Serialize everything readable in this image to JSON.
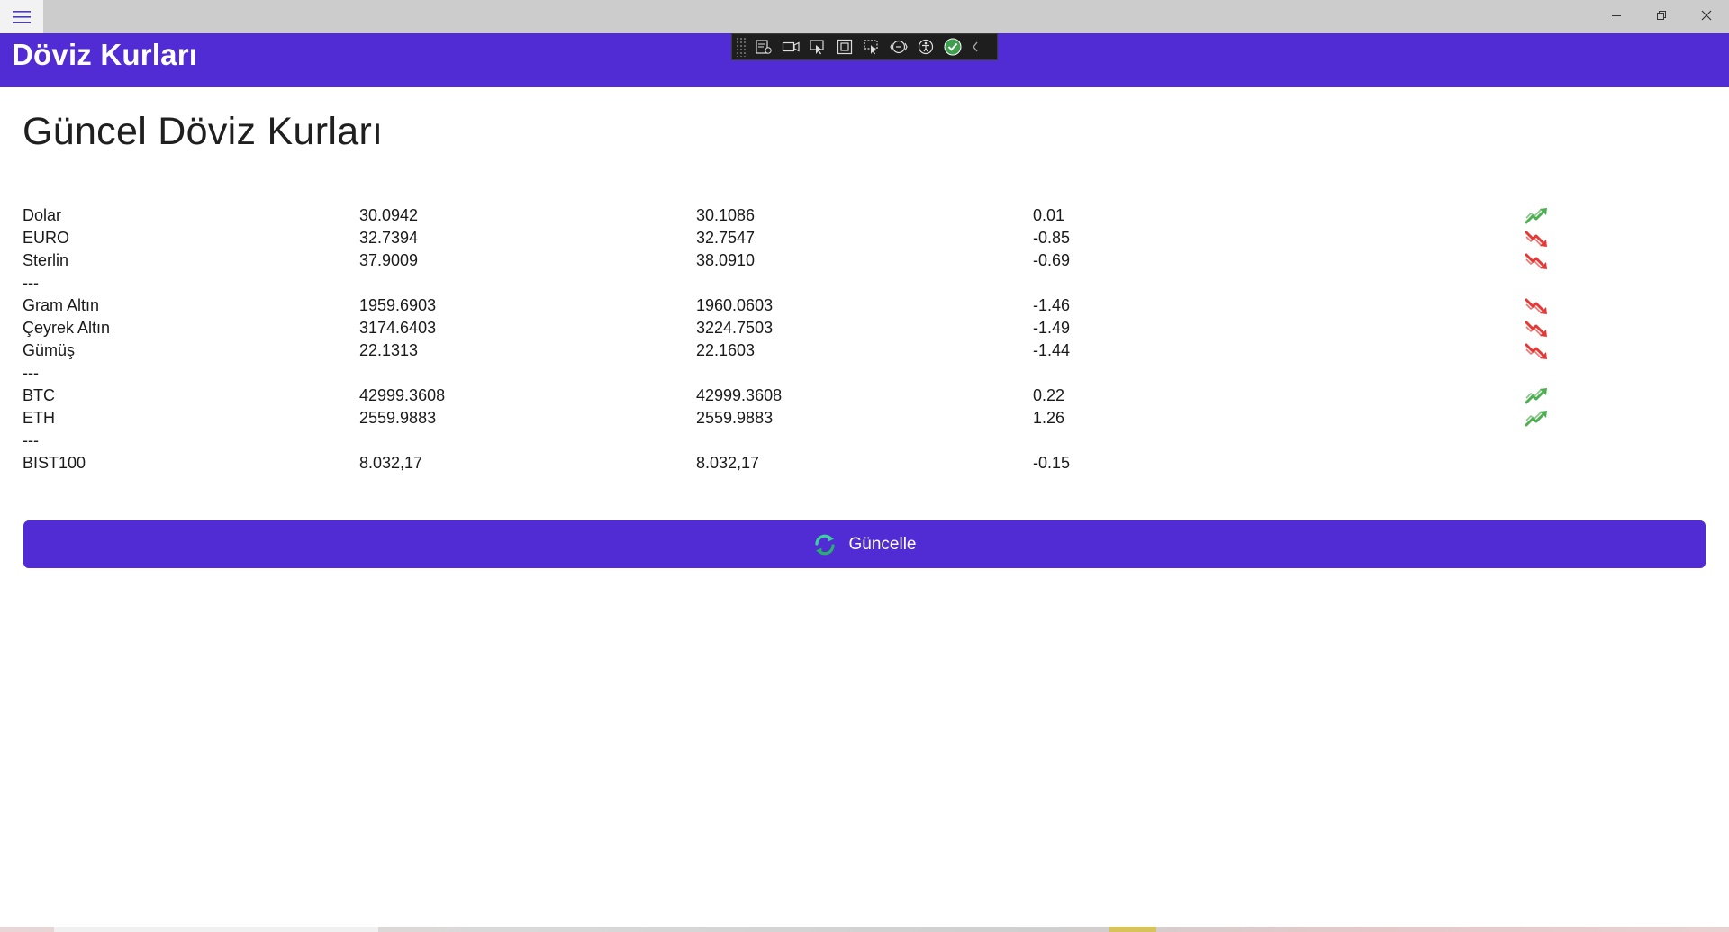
{
  "window": {
    "menu_icon": "hamburger-icon",
    "controls": [
      "minimize-icon",
      "restore-icon",
      "close-icon"
    ]
  },
  "app": {
    "title": "Döviz Kurları",
    "accent": "#512bd4"
  },
  "debug_toolbar": {
    "icons": [
      "live-visual-tree-icon",
      "record-icon",
      "select-element-icon",
      "display-layout-adorners-icon",
      "track-focus-icon",
      "binding-failures-icon",
      "accessibility-checker-icon",
      "checkmark-icon",
      "collapse-chevron-icon"
    ]
  },
  "page": {
    "heading": "Güncel Döviz Kurları"
  },
  "rates": [
    {
      "name": "Dolar",
      "buy": "30.0942",
      "sell": "30.1086",
      "change": "0.01",
      "trend": "up"
    },
    {
      "name": "EURO",
      "buy": "32.7394",
      "sell": "32.7547",
      "change": "-0.85",
      "trend": "down"
    },
    {
      "name": "Sterlin",
      "buy": "37.9009",
      "sell": "38.0910",
      "change": "-0.69",
      "trend": "down"
    },
    {
      "separator": "---"
    },
    {
      "name": "Gram Altın",
      "buy": "1959.6903",
      "sell": "1960.0603",
      "change": "-1.46",
      "trend": "down"
    },
    {
      "name": "Çeyrek Altın",
      "buy": "3174.6403",
      "sell": "3224.7503",
      "change": "-1.49",
      "trend": "down"
    },
    {
      "name": "Gümüş",
      "buy": "22.1313",
      "sell": "22.1603",
      "change": "-1.44",
      "trend": "down"
    },
    {
      "separator": "---"
    },
    {
      "name": "BTC",
      "buy": "42999.3608",
      "sell": "42999.3608",
      "change": "0.22",
      "trend": "up"
    },
    {
      "name": "ETH",
      "buy": "2559.9883",
      "sell": "2559.9883",
      "change": "1.26",
      "trend": "up"
    },
    {
      "separator": "---"
    },
    {
      "name": "BIST100",
      "buy": "8.032,17",
      "sell": "8.032,17",
      "change": "-0.15",
      "trend": "none"
    }
  ],
  "trend_colors": {
    "up": "#4caf50",
    "down": "#e53935"
  },
  "update_button": {
    "label": "Güncelle",
    "icon": "refresh-icon"
  }
}
